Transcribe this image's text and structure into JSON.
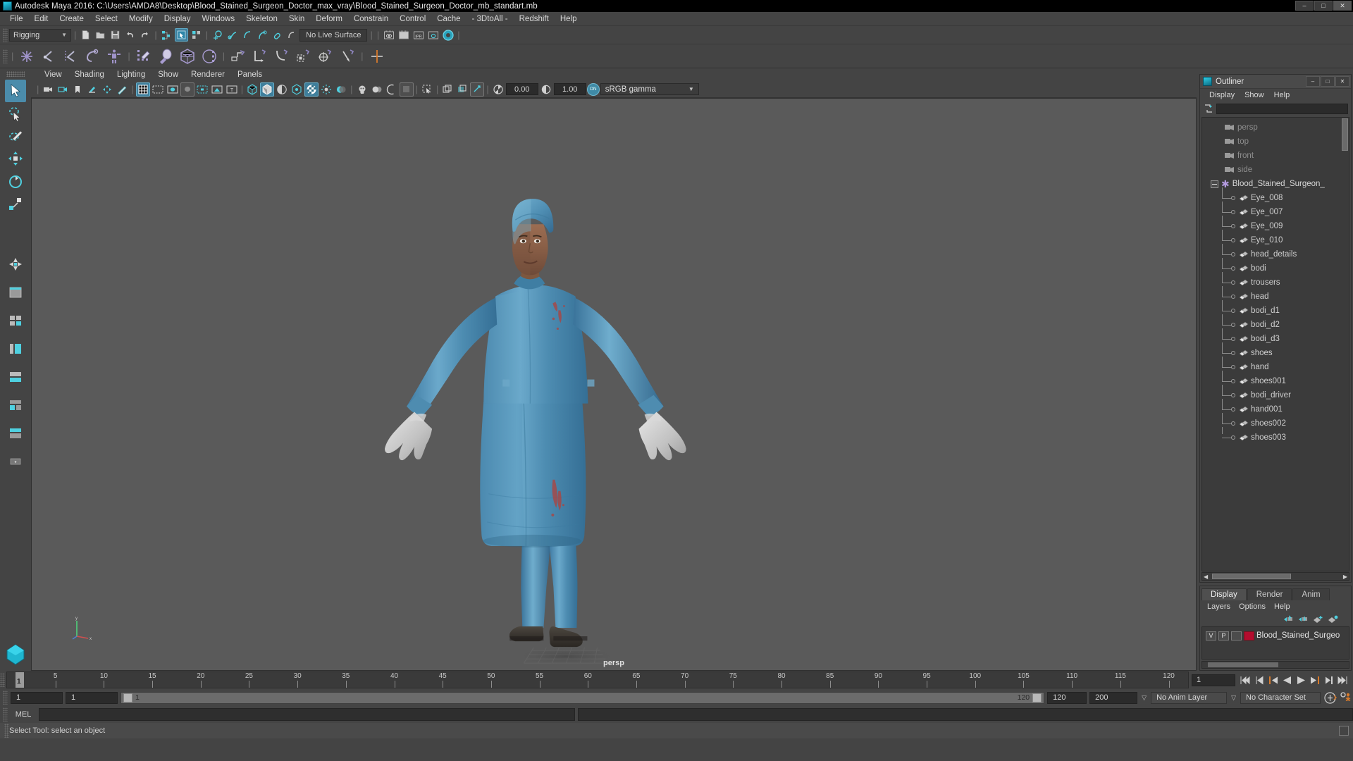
{
  "window": {
    "title": "Autodesk Maya 2016: C:\\Users\\AMDA8\\Desktop\\Blood_Stained_Surgeon_Doctor_max_vray\\Blood_Stained_Surgeon_Doctor_mb_standart.mb",
    "minimize": "–",
    "maximize": "□",
    "close": "✕"
  },
  "menubar": {
    "items": [
      "File",
      "Edit",
      "Create",
      "Select",
      "Modify",
      "Display",
      "Windows",
      "Skeleton",
      "Skin",
      "Deform",
      "Constrain",
      "Control",
      "Cache",
      "- 3DtoAll -",
      "Redshift",
      "Help"
    ]
  },
  "statusline": {
    "mode": "Rigging",
    "live_surface": "No Live Surface",
    "icons": [
      "new-scene-icon",
      "open-scene-icon",
      "save-scene-icon",
      "undo-icon",
      "redo-icon",
      "select-by-hierarchy-icon",
      "select-by-object-icon",
      "select-by-component-icon",
      "snap-to-grid-icon",
      "snap-to-curve-icon",
      "snap-to-point-icon",
      "snap-to-projected-center-icon",
      "snap-to-view-plane-icon",
      "make-live-icon",
      "render-current-frame-icon",
      "ipr-render-icon",
      "render-settings-icon",
      "hypershade-icon",
      "render-view-icon"
    ]
  },
  "shelf": {
    "icons": [
      "create-joint-icon",
      "insert-joint-icon",
      "mirror-joint-icon",
      "ik-handle-icon",
      "quick-rig-icon",
      "paint-skin-weights-icon",
      "bind-skin-icon",
      "smooth-bind-icon",
      "interactive-bind-icon",
      "parent-constraint-icon",
      "point-constraint-icon",
      "orient-constraint-icon",
      "scale-constraint-icon",
      "aim-constraint-icon",
      "pole-vector-constraint-icon",
      "lattice-deformer-icon"
    ]
  },
  "toolbox": {
    "tools": [
      "select-tool",
      "lasso-select-tool",
      "paint-select-tool",
      "move-tool",
      "rotate-tool",
      "scale-tool",
      "last-tool",
      "show-manipulator-tool",
      "single-perspective-view",
      "four-view-layout",
      "persp-outliner-layout",
      "persp-graph-layout",
      "hypershade-persp-layout",
      "persp-multi-layout",
      "more-layouts"
    ],
    "selected": "select-tool"
  },
  "viewport": {
    "menus": [
      "View",
      "Shading",
      "Lighting",
      "Show",
      "Renderer",
      "Panels"
    ],
    "camera_label": "persp",
    "exposure": "0.00",
    "gamma": "1.00",
    "view_transform": "sRGB gamma",
    "gamma_toggle": "ON",
    "toolbar_icons": [
      "select-camera-icon",
      "camera-attributes-icon",
      "bookmark-icon",
      "image-plane-icon",
      "2d-pan-zoom-icon",
      "grease-pencil-icon",
      "grid-toggle-icon",
      "film-gate-icon",
      "resolution-gate-icon",
      "gate-mask-icon",
      "film-origin-icon",
      "safe-action-icon",
      "safe-title-icon",
      "wireframe-icon",
      "smooth-shade-icon",
      "flat-shade-icon",
      "smooth-shade-all-icon",
      "textured-icon",
      "use-lights-icon",
      "shadows-icon",
      "screen-space-ao-icon",
      "motion-blur-icon",
      "multisample-icon",
      "isolate-select-icon",
      "xray-icon",
      "xray-joints-icon",
      "xray-active-components-icon",
      "exposure-icon",
      "gamma-icon"
    ]
  },
  "outliner": {
    "title": "Outliner",
    "menus": [
      "Display",
      "Show",
      "Help"
    ],
    "search_value": "",
    "cameras": [
      "persp",
      "top",
      "front",
      "side"
    ],
    "group": "Blood_Stained_Surgeon_",
    "children": [
      "Eye_008",
      "Eye_007",
      "Eye_009",
      "Eye_010",
      "head_details",
      "bodi",
      "trousers",
      "head",
      "bodi_d1",
      "bodi_d2",
      "bodi_d3",
      "shoes",
      "hand",
      "shoes001",
      "bodi_driver",
      "hand001",
      "shoes002",
      "shoes003"
    ]
  },
  "layer_editor": {
    "tabs": [
      "Display",
      "Render",
      "Anim"
    ],
    "active_tab": "Display",
    "menus": [
      "Layers",
      "Options",
      "Help"
    ],
    "icons": [
      "move-layer-up-icon",
      "move-layer-down-icon",
      "new-layer-icon",
      "new-layer-from-selected-icon"
    ],
    "layers": [
      {
        "visibility": "V",
        "playback": "P",
        "shading": "",
        "color": "#b30c2e",
        "name": "Blood_Stained_Surgeo"
      }
    ]
  },
  "timeline": {
    "current_frame": "1",
    "ticks": [
      5,
      10,
      15,
      20,
      25,
      30,
      35,
      40,
      45,
      50,
      55,
      60,
      65,
      70,
      75,
      80,
      85,
      90,
      95,
      100,
      105,
      110,
      115,
      120
    ],
    "end_label": "120",
    "frame_field": "1",
    "playback_buttons": [
      "go-to-start-icon",
      "step-back-keyframe-icon",
      "step-back-frame-icon",
      "play-backwards-icon",
      "play-forwards-icon",
      "step-forward-frame-icon",
      "step-forward-keyframe-icon",
      "go-to-end-icon"
    ]
  },
  "range": {
    "anim_start": "1",
    "range_start": "1",
    "slider_left": "1",
    "slider_right": "120",
    "range_end": "120",
    "anim_end": "200",
    "anim_layer": "No Anim Layer",
    "character_set": "No Character Set",
    "icons": [
      "auto-keyframe-icon",
      "animation-preferences-icon"
    ]
  },
  "command_line": {
    "language": "MEL",
    "input_value": "",
    "output_value": ""
  },
  "status_bar": {
    "message": "Select Tool: select an object"
  },
  "colors": {
    "accent": "#4b8cab",
    "shelf_icon": "#9f93c9",
    "viewport_bg": "#5a5a5a",
    "panel_bg": "#444444",
    "layer_color": "#b30c2e",
    "playback_orange": "#d87a2b"
  }
}
